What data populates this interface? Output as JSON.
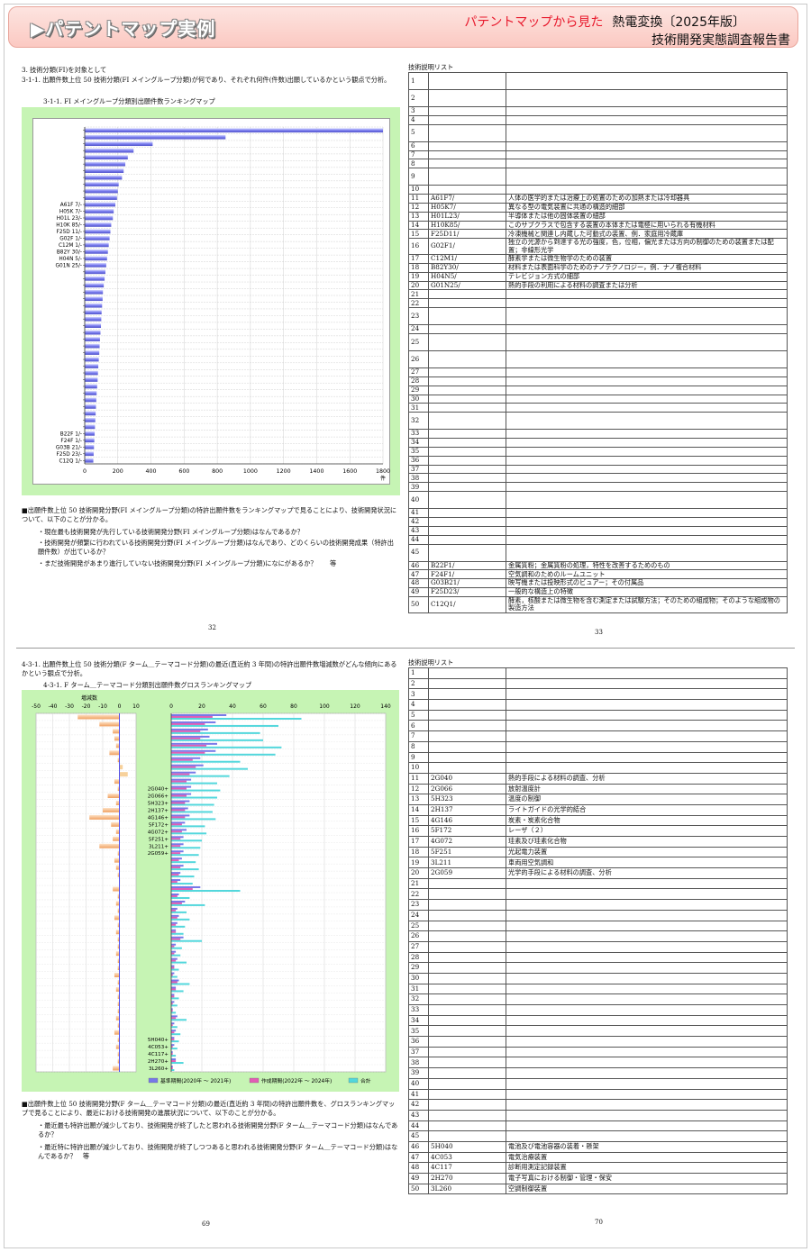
{
  "banner": {
    "title": "パテントマップ実例",
    "right_red": "パテントマップから見た",
    "right_black": "熱電変換〔2025年版〕",
    "subtitle": "技術開発実態調査報告書"
  },
  "top": {
    "heading1": "3. 技術分類(FI)を対象として",
    "heading2": "3-1-1. 出願件数上位 50 技術分類(FI メイングループ分類)が何であり、それぞれ何件(件数)出願しているかという観点で分析。",
    "chart_title": "3-1-1. FI メイングループ分類別出願件数ランキングマップ",
    "notes": [
      "■出願件数上位 50 技術開発分野(FI メイングループ分類)の特許出願件数をランキングマップで見ることにより、技術開発状況について、以下のことが分かる。",
      "・現在最も技術開発が先行している技術開発分野(FI メイングループ分類)はなんであるか？",
      "・技術開発が頻繁に行われている技術開発分野(FI メイングループ分類)はなんであり、どのくらいの技術開発成果（特許出願件数）が出ているか？",
      "・まだ技術開発があまり進行していない技術開発分野(FI メイングループ分類)になにがあるか？　　等"
    ],
    "page_left": "32",
    "page_right": "33",
    "list_title": "技術説明リスト"
  },
  "bottom": {
    "heading": "4-3-1. 出願件数上位 50 技術分類(F ターム＿テーマコード分類)の最近(直近約 3 年間)の特許出願件数増減数がどんな傾向にあるかという観点で分析。",
    "chart_title": "4-3-1. F ターム＿テーマコード分類別出願件数グロスランキングマップ",
    "left_axis_title": "増減数",
    "notes": [
      "■出願件数上位 50 技術開発分野(F ターム＿テーマコード分類)の最近(直近約 3 年間)の特許出願件数を、グロスランキングマップで見ることにより、最近における技術開発の進展状況について、以下のことが分かる。",
      "・最近最も特許出願が減少しており、技術開発が終了したと思われる技術開発分野(F ターム＿テーマコード分類)はなんであるか？",
      "・最近特に特許出願が減少しており、技術開発が終了しつつあると思われる技術開発分野(F ターム＿テーマコード分類)はなんであるか？　等"
    ],
    "page_left": "69",
    "page_right": "70",
    "list_title": "技術説明リスト"
  },
  "chart_data": [
    {
      "type": "bar",
      "title": "3-1-1. FI メイングループ分類別出願件数ランキングマップ",
      "xlabel": "件",
      "xlim": [
        0,
        1800
      ],
      "xticks": [
        0,
        200,
        400,
        600,
        800,
        1000,
        1200,
        1400,
        1600,
        1800
      ],
      "visible_labels": [
        "A61F 7/-",
        "H05K 7/-",
        "H01L 23/-",
        "H10K 85/-",
        "F25D 11/-",
        "G02F 1/-",
        "C12M 1/-",
        "B82Y 30/-",
        "H04N 5/-",
        "G01N 25/-",
        "B22F 1/-",
        "F24F 1/-",
        "G03B 21/-",
        "F25D 23/-",
        "C12Q 1/-"
      ],
      "values": [
        1800,
        850,
        410,
        295,
        260,
        245,
        235,
        225,
        205,
        200,
        195,
        185,
        175,
        170,
        160,
        155,
        150,
        145,
        140,
        135,
        130,
        125,
        120,
        115,
        110,
        108,
        105,
        102,
        100,
        98,
        95,
        92,
        90,
        88,
        85,
        82,
        80,
        78,
        75,
        72,
        70,
        68,
        66,
        64,
        62,
        60,
        58,
        56,
        54,
        52
      ]
    },
    {
      "type": "bar",
      "title": "4-3-1. F ターム＿テーマコード分類別出願件数グロスランキングマップ",
      "left": {
        "title": "増減数",
        "xlim": [
          -50,
          10
        ],
        "xticks": [
          -50,
          -40,
          -30,
          -20,
          -10,
          0,
          10
        ]
      },
      "right": {
        "xlim": [
          0,
          140
        ],
        "xticks": [
          0,
          20,
          40,
          60,
          80,
          100,
          120,
          140
        ]
      },
      "visible_labels": [
        "2G040+",
        "2G066+",
        "5H323+",
        "2H137+",
        "4G146+",
        "5F172+",
        "4G072+",
        "5F251+",
        "3L211+",
        "2G059+",
        "5H040+",
        "4C053+",
        "4C117+",
        "2H270+",
        "3L260+"
      ],
      "legend": [
        "基準期間(2020年 ～ 2021年)",
        "作成期間(2022年 ～ 2024年)",
        "合計"
      ]
    }
  ],
  "list_top": [
    {
      "n": "1",
      "code": "",
      "desc": ""
    },
    {
      "n": "2",
      "code": "",
      "desc": ""
    },
    {
      "n": "3",
      "code": "",
      "desc": ""
    },
    {
      "n": "4",
      "code": "",
      "desc": ""
    },
    {
      "n": "5",
      "code": "",
      "desc": ""
    },
    {
      "n": "6",
      "code": "",
      "desc": ""
    },
    {
      "n": "7",
      "code": "",
      "desc": ""
    },
    {
      "n": "8",
      "code": "",
      "desc": ""
    },
    {
      "n": "9",
      "code": "",
      "desc": ""
    },
    {
      "n": "10",
      "code": "",
      "desc": ""
    },
    {
      "n": "11",
      "code": "A61F7/",
      "desc": "人体の医学的または治療上の処置のための加熱または冷却器具"
    },
    {
      "n": "12",
      "code": "H05K7/",
      "desc": "異なる型の電気装置に共通の構造的細部"
    },
    {
      "n": "13",
      "code": "H01L23/",
      "desc": "半導体または他の固体装置の細部"
    },
    {
      "n": "14",
      "code": "H10K85/",
      "desc": "このサブクラスで包含する装置の本体または電極に用いられる有機材料"
    },
    {
      "n": "15",
      "code": "F25D11/",
      "desc": "冷凍機械と関連し内蔵した可動式の装置、例．家庭用冷蔵庫"
    },
    {
      "n": "16",
      "code": "G02F1/",
      "desc": "独立の光源から到達する光の強度，色，位相，偏光または方向の制御のための装置または配置；非線形光学"
    },
    {
      "n": "17",
      "code": "C12M1/",
      "desc": "酵素学または微生物学のための装置"
    },
    {
      "n": "18",
      "code": "B82Y30/",
      "desc": "材料または表面科学のためのナノテクノロジー，例．ナノ複合材料"
    },
    {
      "n": "19",
      "code": "H04N5/",
      "desc": "テレビジョン方式の細部"
    },
    {
      "n": "20",
      "code": "G01N25/",
      "desc": "熱的手段の利用による材料の調査または分析"
    },
    {
      "n": "21",
      "code": "",
      "desc": ""
    },
    {
      "n": "22",
      "code": "",
      "desc": ""
    },
    {
      "n": "23",
      "code": "",
      "desc": ""
    },
    {
      "n": "24",
      "code": "",
      "desc": ""
    },
    {
      "n": "25",
      "code": "",
      "desc": ""
    },
    {
      "n": "26",
      "code": "",
      "desc": ""
    },
    {
      "n": "27",
      "code": "",
      "desc": ""
    },
    {
      "n": "28",
      "code": "",
      "desc": ""
    },
    {
      "n": "29",
      "code": "",
      "desc": ""
    },
    {
      "n": "30",
      "code": "",
      "desc": ""
    },
    {
      "n": "31",
      "code": "",
      "desc": ""
    },
    {
      "n": "32",
      "code": "",
      "desc": ""
    },
    {
      "n": "33",
      "code": "",
      "desc": ""
    },
    {
      "n": "34",
      "code": "",
      "desc": ""
    },
    {
      "n": "35",
      "code": "",
      "desc": ""
    },
    {
      "n": "36",
      "code": "",
      "desc": ""
    },
    {
      "n": "37",
      "code": "",
      "desc": ""
    },
    {
      "n": "38",
      "code": "",
      "desc": ""
    },
    {
      "n": "39",
      "code": "",
      "desc": ""
    },
    {
      "n": "40",
      "code": "",
      "desc": ""
    },
    {
      "n": "41",
      "code": "",
      "desc": ""
    },
    {
      "n": "42",
      "code": "",
      "desc": ""
    },
    {
      "n": "43",
      "code": "",
      "desc": ""
    },
    {
      "n": "44",
      "code": "",
      "desc": ""
    },
    {
      "n": "45",
      "code": "",
      "desc": ""
    },
    {
      "n": "46",
      "code": "B22F1/",
      "desc": "金属質粉；金属質粉の処理，特性を改善するためのもの"
    },
    {
      "n": "47",
      "code": "F24F1/",
      "desc": "空気調和のためのルームユニット"
    },
    {
      "n": "48",
      "code": "G03B21/",
      "desc": "映写機または投映形式のビュアー；その付属品"
    },
    {
      "n": "49",
      "code": "F25D23/",
      "desc": "一般的な構造上の特徴"
    },
    {
      "n": "50",
      "code": "C12Q1/",
      "desc": "酵素，核酸または微生物を含む測定または試験方法；そのための組成物；そのような組成物の製造方法"
    }
  ],
  "list_bottom": [
    {
      "n": "1",
      "code": "",
      "desc": ""
    },
    {
      "n": "2",
      "code": "",
      "desc": ""
    },
    {
      "n": "3",
      "code": "",
      "desc": ""
    },
    {
      "n": "4",
      "code": "",
      "desc": ""
    },
    {
      "n": "5",
      "code": "",
      "desc": ""
    },
    {
      "n": "6",
      "code": "",
      "desc": ""
    },
    {
      "n": "7",
      "code": "",
      "desc": ""
    },
    {
      "n": "8",
      "code": "",
      "desc": ""
    },
    {
      "n": "9",
      "code": "",
      "desc": ""
    },
    {
      "n": "10",
      "code": "",
      "desc": ""
    },
    {
      "n": "11",
      "code": "2G040",
      "desc": "熱的手段による材料の調査、分析"
    },
    {
      "n": "12",
      "code": "2G066",
      "desc": "放射温度計"
    },
    {
      "n": "13",
      "code": "5H323",
      "desc": "温度の制御"
    },
    {
      "n": "14",
      "code": "2H137",
      "desc": "ライトガイドの光学的結合"
    },
    {
      "n": "15",
      "code": "4G146",
      "desc": "炭素・炭素化合物"
    },
    {
      "n": "16",
      "code": "5F172",
      "desc": "レーザ（２）"
    },
    {
      "n": "17",
      "code": "4G072",
      "desc": "珪素及び珪素化合物"
    },
    {
      "n": "18",
      "code": "5F251",
      "desc": "光起電力装置"
    },
    {
      "n": "19",
      "code": "3L211",
      "desc": "車両用空気調和"
    },
    {
      "n": "20",
      "code": "2G059",
      "desc": "光学的手段による材料の調査、分析"
    },
    {
      "n": "21",
      "code": "",
      "desc": ""
    },
    {
      "n": "22",
      "code": "",
      "desc": ""
    },
    {
      "n": "23",
      "code": "",
      "desc": ""
    },
    {
      "n": "24",
      "code": "",
      "desc": ""
    },
    {
      "n": "25",
      "code": "",
      "desc": ""
    },
    {
      "n": "26",
      "code": "",
      "desc": ""
    },
    {
      "n": "27",
      "code": "",
      "desc": ""
    },
    {
      "n": "28",
      "code": "",
      "desc": ""
    },
    {
      "n": "29",
      "code": "",
      "desc": ""
    },
    {
      "n": "30",
      "code": "",
      "desc": ""
    },
    {
      "n": "31",
      "code": "",
      "desc": ""
    },
    {
      "n": "32",
      "code": "",
      "desc": ""
    },
    {
      "n": "33",
      "code": "",
      "desc": ""
    },
    {
      "n": "34",
      "code": "",
      "desc": ""
    },
    {
      "n": "35",
      "code": "",
      "desc": ""
    },
    {
      "n": "36",
      "code": "",
      "desc": ""
    },
    {
      "n": "37",
      "code": "",
      "desc": ""
    },
    {
      "n": "38",
      "code": "",
      "desc": ""
    },
    {
      "n": "39",
      "code": "",
      "desc": ""
    },
    {
      "n": "40",
      "code": "",
      "desc": ""
    },
    {
      "n": "41",
      "code": "",
      "desc": ""
    },
    {
      "n": "42",
      "code": "",
      "desc": ""
    },
    {
      "n": "43",
      "code": "",
      "desc": ""
    },
    {
      "n": "44",
      "code": "",
      "desc": ""
    },
    {
      "n": "45",
      "code": "",
      "desc": ""
    },
    {
      "n": "46",
      "code": "5H040",
      "desc": "電池及び電池容器の装着・懸架"
    },
    {
      "n": "47",
      "code": "4C053",
      "desc": "電気治療装置"
    },
    {
      "n": "48",
      "code": "4C117",
      "desc": "診断用測定記録装置"
    },
    {
      "n": "49",
      "code": "2H270",
      "desc": "電子写真における制御・管理・保安"
    },
    {
      "n": "50",
      "code": "3L260",
      "desc": "空調制御装置"
    }
  ]
}
